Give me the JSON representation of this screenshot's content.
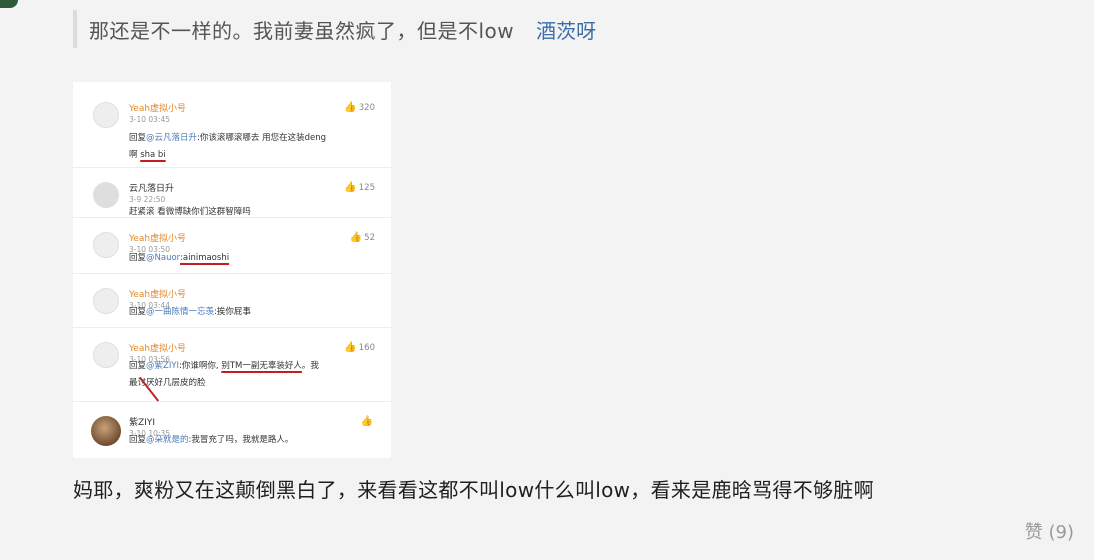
{
  "quote": {
    "text": "那还是不一样的。我前妻虽然疯了，但是不low",
    "user": "酒茨呀"
  },
  "screenshot": {
    "comments": [
      {
        "name": "Yeah虚拟小号",
        "time": "3-10 03:45",
        "likes": "320",
        "reply_prefix": "回复",
        "mention": "@云凡落日升",
        "text_before": ":你该滚哪滚哪去 用您在这装deng",
        "text_line2_prefix": "啊 ",
        "underlined": "sha bi"
      },
      {
        "name": "云凡落日升",
        "time": "3-9 22:50",
        "likes": "125",
        "text": "赶紧滚 看微博缺你们这群智障吗"
      },
      {
        "name": "Yeah虚拟小号",
        "time": "3-10 03:50",
        "likes": "52",
        "reply_prefix": "回复",
        "mention": "@Nauor",
        "underlined": ":ainimaoshi"
      },
      {
        "name": "Yeah虚拟小号",
        "time": "3-10 03:44",
        "reply_prefix": "回复",
        "mention": "@一曲陈情一忘羡",
        "text": ":挨你屁事"
      },
      {
        "name": "Yeah虚拟小号",
        "time": "3-10 03:56",
        "likes": "160",
        "reply_prefix": "回复",
        "mention": "@紫ZIYI",
        "text_before": ":你谁啊你, ",
        "underlined": "别TM一副无辜装好人",
        "text_after": "。我",
        "text_line2": "最讨厌好几层皮的脸"
      },
      {
        "name": "紫ZIYI",
        "time": "3-10 10:35",
        "reply_prefix": "回复",
        "mention": "@朵就是的",
        "text": ":我冒充了吗，我就是路人。"
      }
    ]
  },
  "body": {
    "text": "妈耶，爽粉又在这颠倒黑白了，来看看这都不叫low什么叫low，看来是鹿晗骂得不够脏啊"
  },
  "likes": {
    "label": "赞 (9)"
  }
}
